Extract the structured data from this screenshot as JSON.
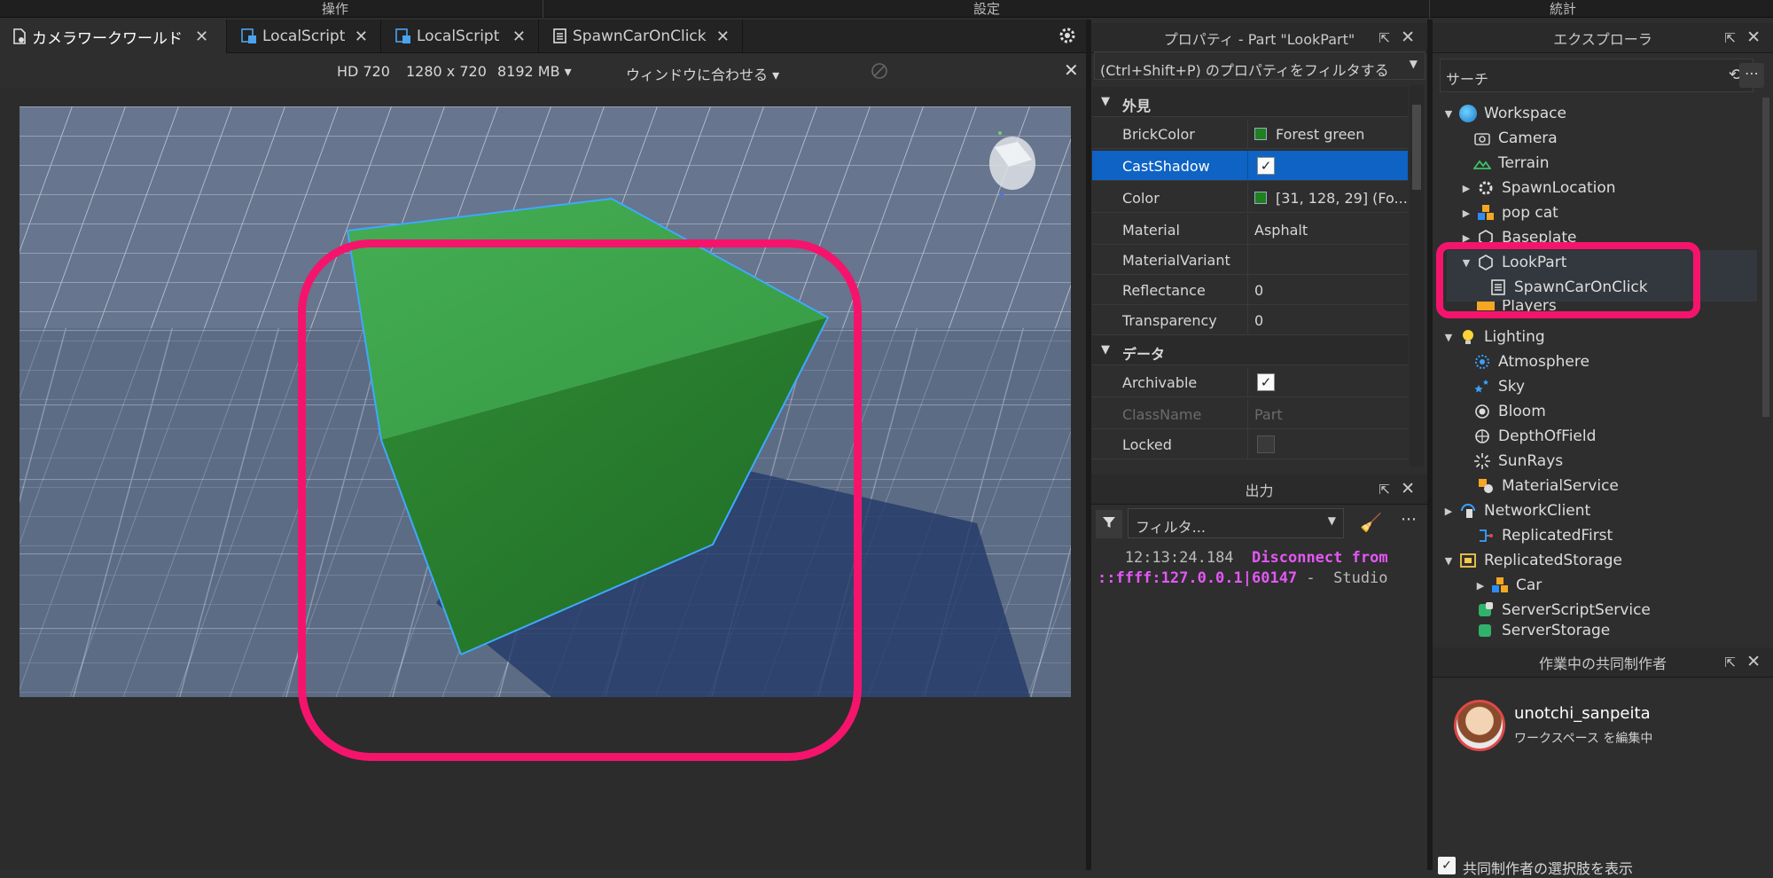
{
  "menubar": {
    "operate": "操作",
    "settings": "設定",
    "stats": "統計"
  },
  "tabs": [
    {
      "label": "カメラワークワールド",
      "close": "✕"
    },
    {
      "label": "LocalScript",
      "close": "✕"
    },
    {
      "label": "LocalScript",
      "close": "✕"
    },
    {
      "label": "SpawnCarOnClick",
      "close": "✕"
    }
  ],
  "viewport_bar": {
    "resolution": "HD 720",
    "size": "1280 x 720",
    "memory": "8192 MB ▾",
    "fit": "ウィンドウに合わせる ▾"
  },
  "properties": {
    "title": "プロパティ - Part \"LookPart\"",
    "filter": "(Ctrl+Shift+P) のプロパティをフィルタする",
    "cat_appearance": "外見",
    "cat_data": "データ",
    "rows": [
      {
        "name": "BrickColor",
        "value": "Forest green"
      },
      {
        "name": "CastShadow",
        "value": "✓"
      },
      {
        "name": "Color",
        "value": "[31, 128, 29] (Fo..."
      },
      {
        "name": "Material",
        "value": "Asphalt"
      },
      {
        "name": "MaterialVariant",
        "value": ""
      },
      {
        "name": "Reflectance",
        "value": "0"
      },
      {
        "name": "Transparency",
        "value": "0"
      },
      {
        "name": "Archivable",
        "value": "✓"
      },
      {
        "name": "ClassName",
        "value": "Part"
      },
      {
        "name": "Locked",
        "value": ""
      }
    ]
  },
  "output": {
    "title": "出力",
    "filter": "フィルタ...",
    "time": "12:13:24.184",
    "msg1": "Disconnect from",
    "msg2": "::ffff:127.0.0.1|60147",
    "msg3": " -  Studio"
  },
  "explorer": {
    "title": "エクスプローラ",
    "search": "サーチ",
    "items": [
      "Workspace",
      "Camera",
      "Terrain",
      "SpawnLocation",
      "pop cat",
      "Baseplate",
      "LookPart",
      "SpawnCarOnClick",
      "Players",
      "Lighting",
      "Atmosphere",
      "Sky",
      "Bloom",
      "DepthOfField",
      "SunRays",
      "MaterialService",
      "NetworkClient",
      "ReplicatedFirst",
      "ReplicatedStorage",
      "Car",
      "ServerScriptService",
      "ServerStorage"
    ]
  },
  "collab": {
    "title": "作業中の共同制作者",
    "user": "unotchi_sanpeita",
    "status": "ワークスペース を編集中",
    "footer": "共同制作者の選択肢を表示"
  },
  "colors": {
    "accent_select": "#0e63c4",
    "highlight": "#f5146c",
    "part_green": "#1f801d"
  }
}
